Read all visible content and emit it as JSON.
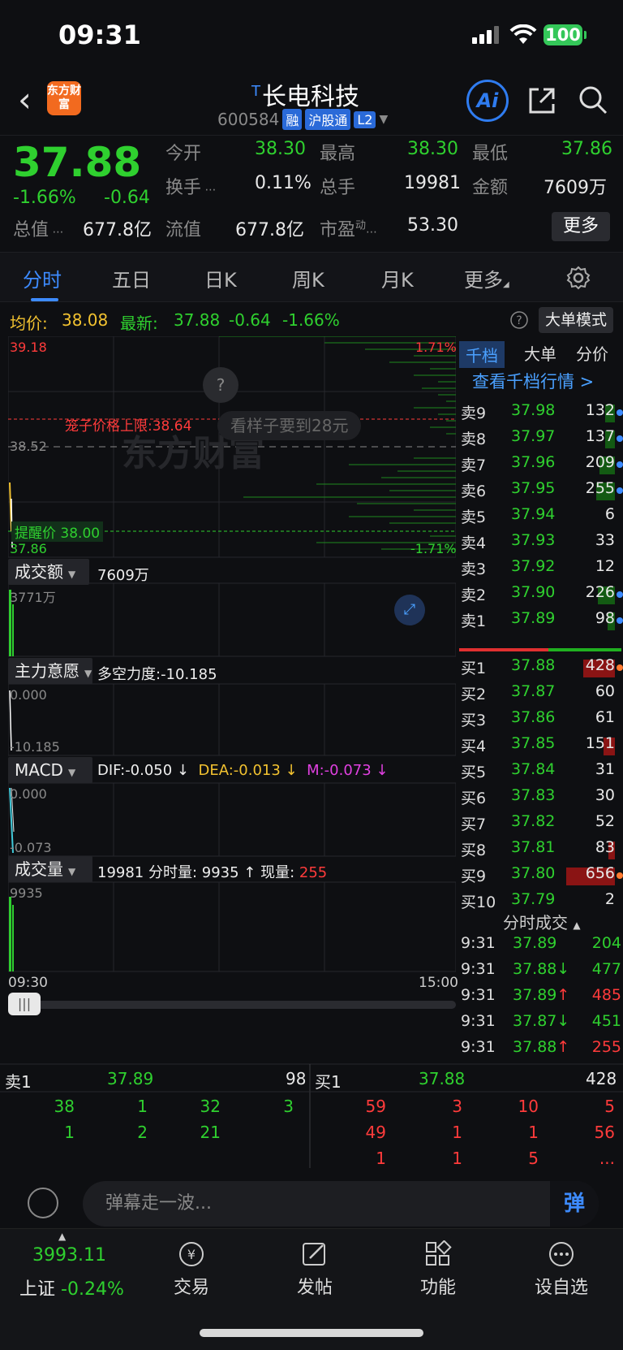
{
  "status": {
    "time": "09:31",
    "battery": "100"
  },
  "header": {
    "logo": "东方财富",
    "name": "长电科技",
    "name_mark": "T",
    "code": "600584",
    "tags": [
      "融",
      "沪股通",
      "L2"
    ],
    "ai": "Ai"
  },
  "quote": {
    "price": "37.88",
    "chg_pct": "-1.66%",
    "chg": "-0.64",
    "labels": {
      "open": "今开",
      "high": "最高",
      "low": "最低",
      "turnover": "换手",
      "vol": "总手",
      "amount": "金额",
      "mcap": "总值",
      "float": "流值",
      "pe": "市盈",
      "pe_sup": "动"
    },
    "open": "38.30",
    "high": "38.30",
    "low": "37.86",
    "turnover": "0.11%",
    "vol": "19981",
    "amount": "7609万",
    "mcap": "677.8亿",
    "float": "677.8亿",
    "pe": "53.30",
    "more": "更多"
  },
  "tabs": [
    "分时",
    "五日",
    "日K",
    "周K",
    "月K",
    "更多"
  ],
  "avgline": {
    "avg_label": "均价:",
    "avg": "38.08",
    "last_label": "最新:",
    "last": "37.88",
    "chg": "-0.64",
    "pct": "-1.66%",
    "bigmode": "大单模式"
  },
  "chart": {
    "top_price": "39.18",
    "top_pct": "1.71%",
    "mid_price": "38.52",
    "bot_price": "37.86",
    "bot_pct": "-1.71%",
    "cage_label": "笼子价格上限:",
    "cage_value": "38.64",
    "alert_label": "提醒价",
    "alert_value": "38.00",
    "watermark": "东方财富",
    "promo": "看样子要到28元",
    "help": "?",
    "amount_label": "成交额",
    "amount_val": "7609万",
    "amount_axis": "3771万",
    "main_label": "主力意愿",
    "main_info": "多空力度:-10.185",
    "main_top": "0.000",
    "main_bot": "-10.185",
    "macd_label": "MACD",
    "dif": "DIF:-0.050 ↓",
    "dea": "DEA:-0.013 ↓",
    "m": "M:-0.073 ↓",
    "macd_top": "0.000",
    "macd_bot": "-0.073",
    "vol_label": "成交量",
    "vol_info": "19981 分时量: 9935 ↑ 现量:",
    "vol_now": "255",
    "vol_axis": "9935",
    "t_start": "09:30",
    "t_end": "15:00"
  },
  "depth": {
    "tabs": [
      "千档",
      "大单",
      "分价"
    ],
    "link": "查看千档行情 >",
    "asks": [
      {
        "label": "卖9",
        "price": "37.98",
        "vol": "132"
      },
      {
        "label": "卖8",
        "price": "37.97",
        "vol": "137"
      },
      {
        "label": "卖7",
        "price": "37.96",
        "vol": "209"
      },
      {
        "label": "卖6",
        "price": "37.95",
        "vol": "255"
      },
      {
        "label": "卖5",
        "price": "37.94",
        "vol": "6"
      },
      {
        "label": "卖4",
        "price": "37.93",
        "vol": "33"
      },
      {
        "label": "卖3",
        "price": "37.92",
        "vol": "12"
      },
      {
        "label": "卖2",
        "price": "37.90",
        "vol": "226"
      },
      {
        "label": "卖1",
        "price": "37.89",
        "vol": "98"
      }
    ],
    "bids": [
      {
        "label": "买1",
        "price": "37.88",
        "vol": "428"
      },
      {
        "label": "买2",
        "price": "37.87",
        "vol": "60"
      },
      {
        "label": "买3",
        "price": "37.86",
        "vol": "61"
      },
      {
        "label": "买4",
        "price": "37.85",
        "vol": "151"
      },
      {
        "label": "买5",
        "price": "37.84",
        "vol": "31"
      },
      {
        "label": "买6",
        "price": "37.83",
        "vol": "30"
      },
      {
        "label": "买7",
        "price": "37.82",
        "vol": "52"
      },
      {
        "label": "买8",
        "price": "37.81",
        "vol": "83"
      },
      {
        "label": "买9",
        "price": "37.80",
        "vol": "656"
      },
      {
        "label": "买10",
        "price": "37.79",
        "vol": "2"
      }
    ],
    "ticks_title": "分时成交",
    "ticks": [
      {
        "t": "9:31",
        "p": "37.89",
        "v": "204"
      },
      {
        "t": "9:31",
        "p": "37.88↓",
        "v": "477"
      },
      {
        "t": "9:31",
        "p": "37.89↑",
        "v": "485"
      },
      {
        "t": "9:31",
        "p": "37.87↓",
        "v": "451"
      },
      {
        "t": "9:31",
        "p": "37.88↑",
        "v": "255"
      }
    ]
  },
  "bottomq": {
    "ask_label": "卖1",
    "ask_price": "37.89",
    "ask_vol": "98",
    "bid_label": "买1",
    "bid_price": "37.88",
    "bid_vol": "428",
    "ask_rows": [
      [
        "38",
        "1",
        "32",
        "3"
      ],
      [
        "1",
        "2",
        "21",
        ""
      ]
    ],
    "bid_rows": [
      [
        "59",
        "3",
        "10",
        "5"
      ],
      [
        "49",
        "1",
        "1",
        "56"
      ],
      [
        "1",
        "1",
        "5",
        "..."
      ]
    ]
  },
  "danmu": {
    "placeholder": "弹幕走一波...",
    "btn": "弹"
  },
  "nav": {
    "index_value": "3993.11",
    "index_name": "上证",
    "index_pct": "-0.24%",
    "items": [
      "交易",
      "发帖",
      "功能",
      "设自选"
    ]
  }
}
